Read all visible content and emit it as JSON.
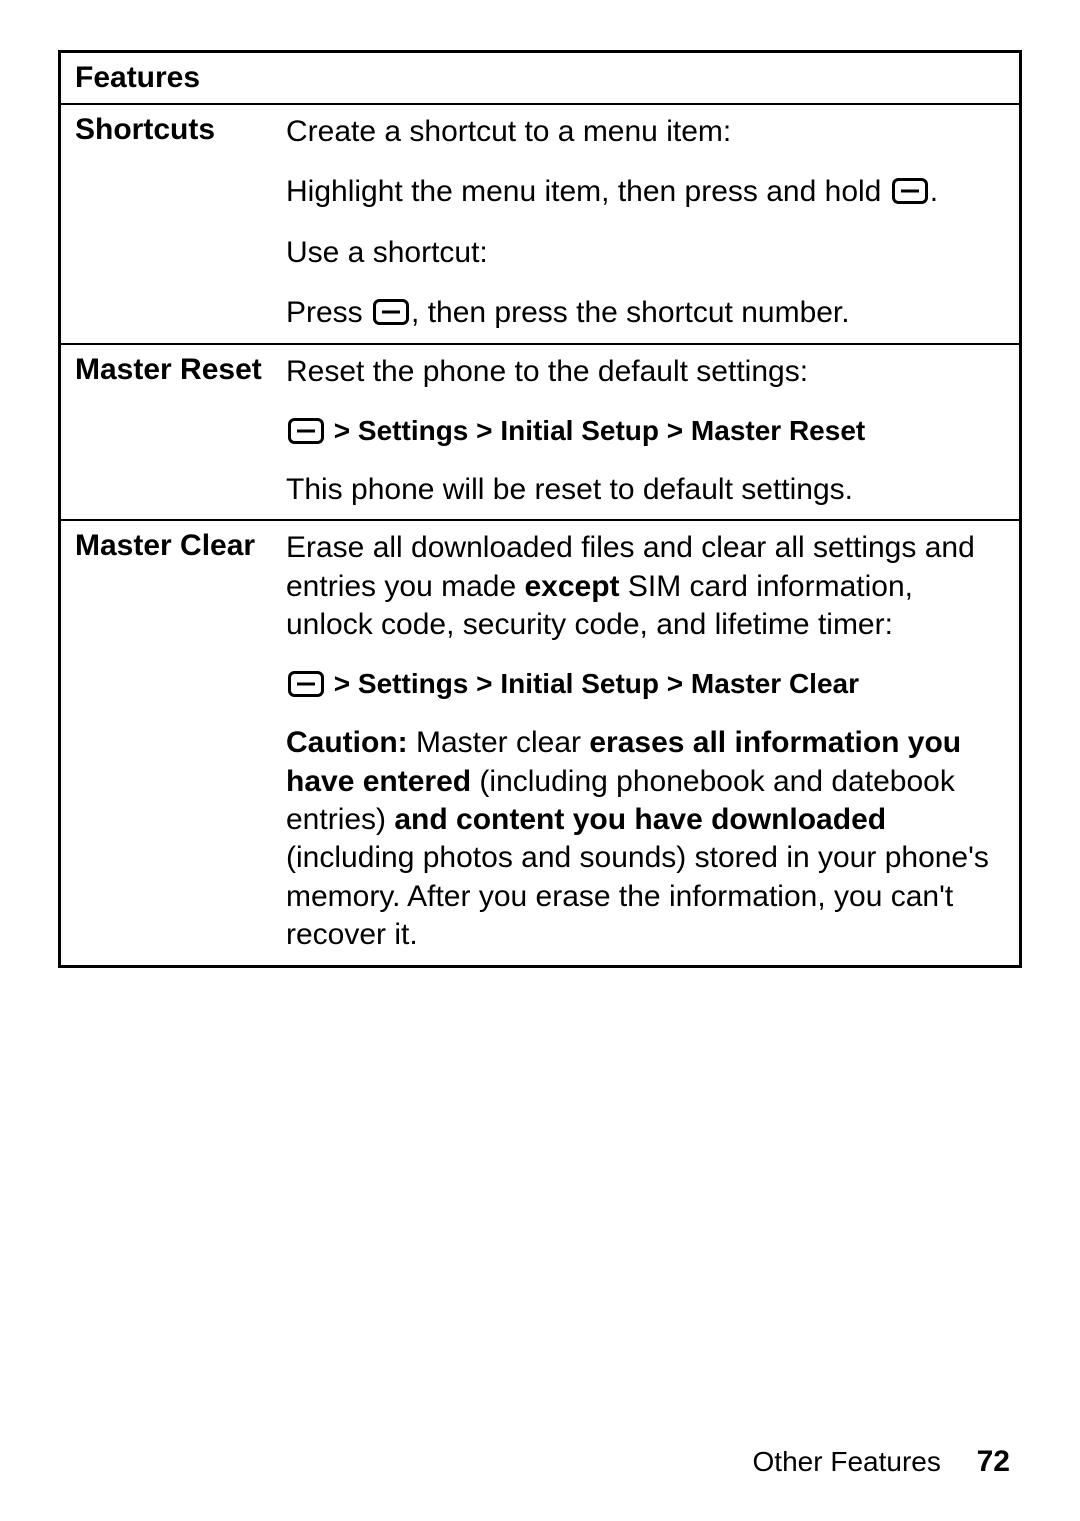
{
  "table": {
    "header": "Features",
    "rows": [
      {
        "label": "Shortcuts",
        "paras": [
          {
            "type": "plain",
            "text": "Create a shortcut to a menu item:"
          },
          {
            "type": "icon-after",
            "pre": "Highlight the menu item, then press and hold ",
            "post": "."
          },
          {
            "type": "plain",
            "text": "Use a shortcut:"
          },
          {
            "type": "icon-mid",
            "pre": "Press ",
            "post": ", then press the shortcut number."
          }
        ]
      },
      {
        "label": "Master Reset",
        "paras": [
          {
            "type": "plain",
            "text": "Reset the phone to the default settings:"
          },
          {
            "type": "nav",
            "sep": " > ",
            "items": [
              "Settings",
              "Initial Setup",
              "Master Reset"
            ]
          },
          {
            "type": "plain",
            "text": "This phone will be reset to default settings."
          }
        ]
      },
      {
        "label": "Master Clear",
        "paras": [
          {
            "type": "except",
            "pre": "Erase all downloaded files and clear all settings and entries you made ",
            "bold": "except",
            "post": " SIM card information, unlock code, security code, and lifetime timer:"
          },
          {
            "type": "nav",
            "sep": " > ",
            "items": [
              "Settings",
              "Initial Setup",
              "Master Clear"
            ]
          },
          {
            "type": "caution",
            "parts": [
              {
                "bold": true,
                "text": "Caution:"
              },
              {
                "bold": false,
                "text": " Master clear "
              },
              {
                "bold": true,
                "text": "erases all information you have entered"
              },
              {
                "bold": false,
                "text": " (including phonebook and datebook entries) "
              },
              {
                "bold": true,
                "text": "and content you have downloaded"
              },
              {
                "bold": false,
                "text": " (including photos and sounds) stored in your phone's memory. After you erase the information, you can't recover it."
              }
            ]
          }
        ]
      }
    ]
  },
  "footer": {
    "section": "Other Features",
    "page": "72"
  }
}
